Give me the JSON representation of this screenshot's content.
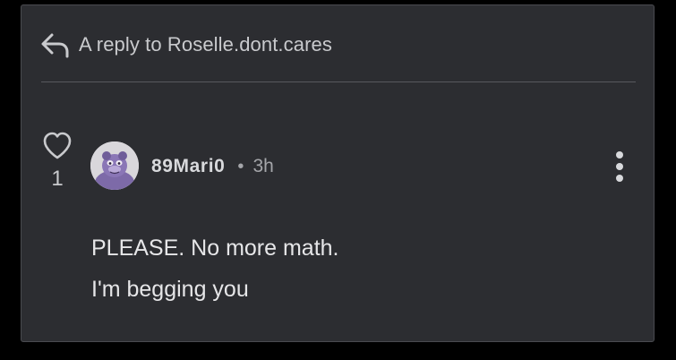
{
  "reply": {
    "label": "A reply to Roselle.dont.cares",
    "icon": "reply-arrow-icon"
  },
  "comment": {
    "likes": "1",
    "author": "89Mari0",
    "separator": "•",
    "time": "3h",
    "lines": [
      "PLEASE. No more math.",
      "I'm begging you"
    ]
  },
  "colors": {
    "background": "#000000",
    "card": "#2c2d31",
    "text": "#e6e6e8",
    "muted": "#a5a6aa"
  }
}
